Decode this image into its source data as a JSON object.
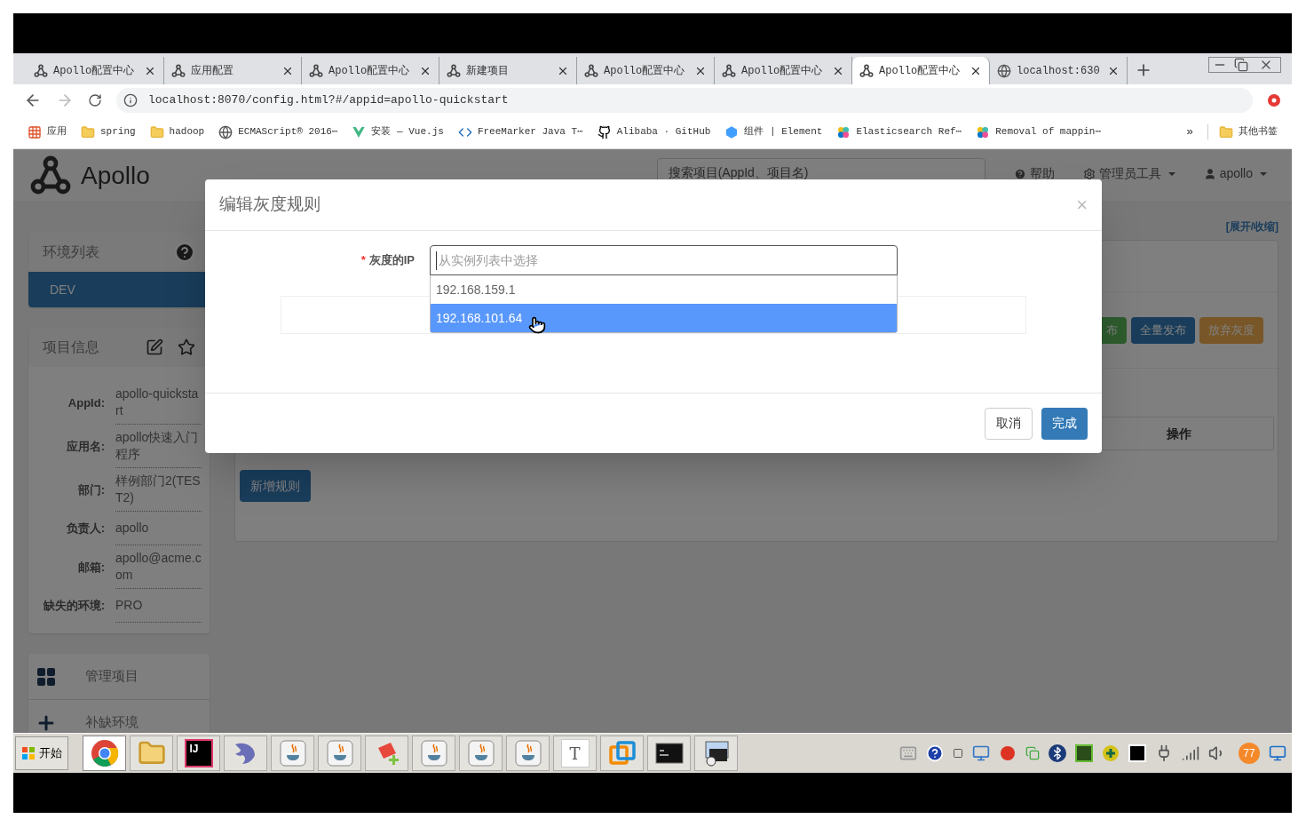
{
  "browser": {
    "tabs": [
      {
        "title": "Apollo配置中心",
        "kind": "apollo",
        "selected": false
      },
      {
        "title": "应用配置",
        "kind": "apollo",
        "selected": false
      },
      {
        "title": "Apollo配置中心",
        "kind": "apollo",
        "selected": false
      },
      {
        "title": "新建项目",
        "kind": "apollo",
        "selected": false
      },
      {
        "title": "Apollo配置中心",
        "kind": "apollo",
        "selected": false
      },
      {
        "title": "Apollo配置中心",
        "kind": "apollo",
        "selected": false
      },
      {
        "title": "Apollo配置中心",
        "kind": "apollo",
        "selected": true
      },
      {
        "title": "localhost:630",
        "kind": "globe",
        "selected": false
      }
    ],
    "address": "localhost:8070/config.html?#/appid=apollo-quickstart",
    "bookmarks": [
      {
        "label": "应用",
        "kind": "apps"
      },
      {
        "label": "spring",
        "kind": "folder"
      },
      {
        "label": "hadoop",
        "kind": "folder"
      },
      {
        "label": "ECMAScript® 2016⋯",
        "kind": "globe"
      },
      {
        "label": "安装 — Vue.js",
        "kind": "vue"
      },
      {
        "label": "FreeMarker Java T⋯",
        "kind": "code"
      },
      {
        "label": "Alibaba · GitHub",
        "kind": "github"
      },
      {
        "label": "组件 | Element",
        "kind": "element"
      },
      {
        "label": "Elasticsearch Ref⋯",
        "kind": "elastic"
      },
      {
        "label": "Removal of mappin⋯",
        "kind": "elastic"
      }
    ],
    "more": "»",
    "other_bookmarks": "其他书签"
  },
  "navbar": {
    "logo": "Apollo",
    "search_placeholder": "搜索项目(AppId、项目名)",
    "help": "帮助",
    "admin": "管理员工具",
    "user": "apollo"
  },
  "sidebar": {
    "env_title": "环境列表",
    "envs": [
      {
        "name": "DEV",
        "selected": true
      }
    ],
    "info_title": "项目信息",
    "fields": [
      {
        "label": "AppId:",
        "value": "apollo-quickstart"
      },
      {
        "label": "应用名:",
        "value": "apollo快速入门程序"
      },
      {
        "label": "部门:",
        "value": "样例部门2(TEST2)"
      },
      {
        "label": "负责人:",
        "value": "apollo"
      },
      {
        "label": "邮箱:",
        "value": "apollo@acme.com"
      },
      {
        "label": "缺失的环境:",
        "value": "PRO"
      }
    ],
    "actions": [
      {
        "label": "管理项目",
        "kind": "manage"
      },
      {
        "label": "补缺环境",
        "kind": "add"
      }
    ]
  },
  "main": {
    "toggle": "[展开/收缩]",
    "buttons": [
      {
        "label": "布",
        "kind": "success"
      },
      {
        "label": "全量发布",
        "kind": "primary"
      },
      {
        "label": "放弃灰度",
        "kind": "warning"
      }
    ],
    "table_header": "操作",
    "add_rule": "新增规则"
  },
  "modal": {
    "title": "编辑灰度规则",
    "close": "×",
    "required": "*",
    "label": "灰度的IP",
    "placeholder": "从实例列表中选择",
    "options": [
      {
        "text": "192.168.159.1",
        "selected": false
      },
      {
        "text": "192.168.101.64",
        "selected": true
      }
    ],
    "cancel": "取消",
    "ok": "完成"
  },
  "taskbar": {
    "start": "开始",
    "apps": [
      {
        "kind": "chrome",
        "active": true
      },
      {
        "kind": "folder",
        "active": false
      },
      {
        "kind": "intellij",
        "glyph": "IJ",
        "active": false
      },
      {
        "kind": "dolphin",
        "active": false
      },
      {
        "kind": "java",
        "active": false
      },
      {
        "kind": "java",
        "active": false
      },
      {
        "kind": "notepad",
        "active": false
      },
      {
        "kind": "java",
        "active": false
      },
      {
        "kind": "java",
        "active": false
      },
      {
        "kind": "java",
        "active": false
      },
      {
        "kind": "typora",
        "glyph": "T",
        "active": false
      },
      {
        "kind": "vmware",
        "active": false
      },
      {
        "kind": "terminal",
        "active": false
      },
      {
        "kind": "remote",
        "active": false
      }
    ],
    "badge": "77"
  }
}
